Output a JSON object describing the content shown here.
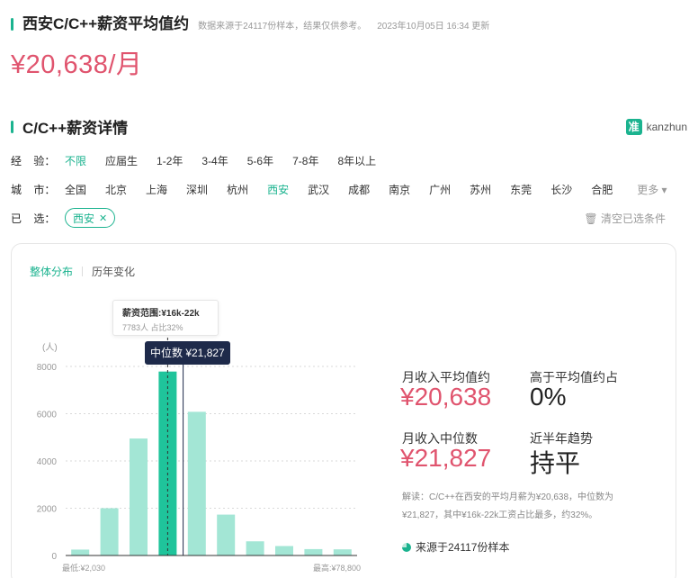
{
  "page": {
    "title": "西安C/C++薪资平均值约",
    "meta": "数据来源于24117份样本，结果仅供参考。",
    "updated": "2023年10月05日 16:34 更新",
    "avg_salary_big": "¥20,638/月"
  },
  "section": {
    "title": "C/C++薪资详情",
    "logo_mark": "准",
    "logo_text": "kanzhun"
  },
  "filters": {
    "experience": {
      "label": "经    验：",
      "options": [
        "不限",
        "应届生",
        "1-2年",
        "3-4年",
        "5-6年",
        "7-8年",
        "8年以上"
      ],
      "active_index": 0
    },
    "city": {
      "label": "城    市：",
      "options": [
        "全国",
        "北京",
        "上海",
        "深圳",
        "杭州",
        "西安",
        "武汉",
        "成都",
        "南京",
        "广州",
        "苏州",
        "东莞",
        "长沙",
        "合肥"
      ],
      "active_index": 5,
      "more_label": "更多 ▾"
    },
    "selected": {
      "label": "已    选：",
      "chip": "西安",
      "chip_close": "✕",
      "clear_label": "清空已选条件"
    }
  },
  "tabs": [
    "整体分布",
    "历年变化"
  ],
  "stats": {
    "avg_label": "月收入平均值约",
    "avg_value": "¥20,638",
    "above_label": "高于平均值约占",
    "above_value": "0%",
    "median_label": "月收入中位数",
    "median_value": "¥21,827",
    "trend_label": "近半年趋势",
    "trend_value": "持平",
    "explain": "解读：C/C++在西安的平均月薪为¥20,638，中位数为¥21,827，其中¥16k-22k工资占比最多，约32%。",
    "source": "来源于24117份样本"
  },
  "tooltip": {
    "range": "薪资范围:¥16k-22k",
    "detail": "7783人  占比32%"
  },
  "median_tag": "中位数 ¥21,827",
  "chart_data": {
    "type": "bar",
    "ylabel": "(人)",
    "ylim": [
      0,
      8000
    ],
    "yticks": [
      0,
      2000,
      4000,
      6000,
      8000
    ],
    "x_min_label": "最低:¥2,030",
    "x_max_label": "最高:¥78,800",
    "values": [
      250,
      2000,
      4950,
      7783,
      6080,
      1730,
      600,
      400,
      270,
      260
    ],
    "highlight_index": 3,
    "median_position_label": "¥21,827",
    "colors": {
      "bar": "#a3e6d5",
      "highlight": "#1fc49b",
      "grid": "#d9d9d9"
    }
  },
  "colors": {
    "accent": "#1bb38f",
    "money": "#e0546e"
  }
}
